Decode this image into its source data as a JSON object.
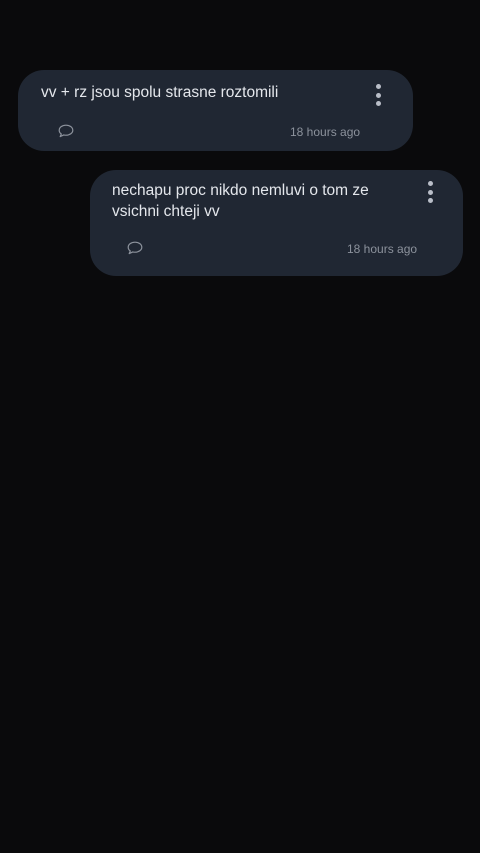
{
  "messages": [
    {
      "text": "vv + rz jsou spolu strasne roztomili",
      "time": "18 hours ago",
      "reply_icon": "speech-bubble-icon",
      "menu_icon": "more-vertical-icon"
    },
    {
      "text": "nechapu proc nikdo nemluvi o tom ze vsichni chteji vv",
      "time": "18 hours ago",
      "reply_icon": "speech-bubble-icon",
      "menu_icon": "more-vertical-icon"
    }
  ],
  "colors": {
    "background": "#0a0a0c",
    "bubble": "#202733",
    "text": "#e4e7ec",
    "muted": "#8c929c"
  }
}
